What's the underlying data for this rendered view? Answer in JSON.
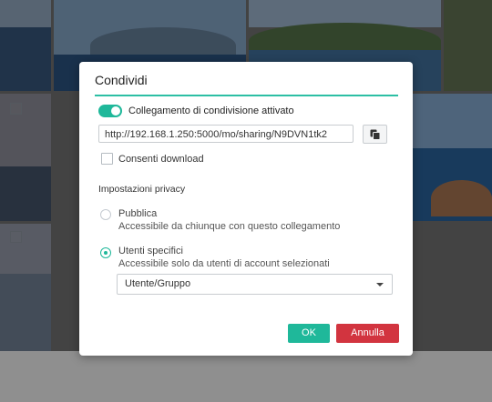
{
  "dialog": {
    "title": "Condividi",
    "share_toggle": {
      "label": "Collegamento di condivisione attivato",
      "on": true
    },
    "share_url": "http://192.168.1.250:5000/mo/sharing/N9DVN1tk2",
    "copy_button_icon": "copy-icon",
    "allow_download": {
      "label": "Consenti download",
      "checked": false
    },
    "privacy": {
      "section_label": "Impostazioni privacy",
      "options": [
        {
          "title": "Pubblica",
          "description": "Accessibile da chiunque con questo collegamento",
          "selected": false
        },
        {
          "title": "Utenti specifici",
          "description": "Accessibile solo da utenti di account selezionati",
          "selected": true
        }
      ],
      "user_group_select": "Utente/Gruppo"
    },
    "ok_label": "OK",
    "cancel_label": "Annulla"
  },
  "colors": {
    "accent": "#1fb89a",
    "cancel": "#d2343f",
    "title_rule": "#2cbfa4"
  }
}
